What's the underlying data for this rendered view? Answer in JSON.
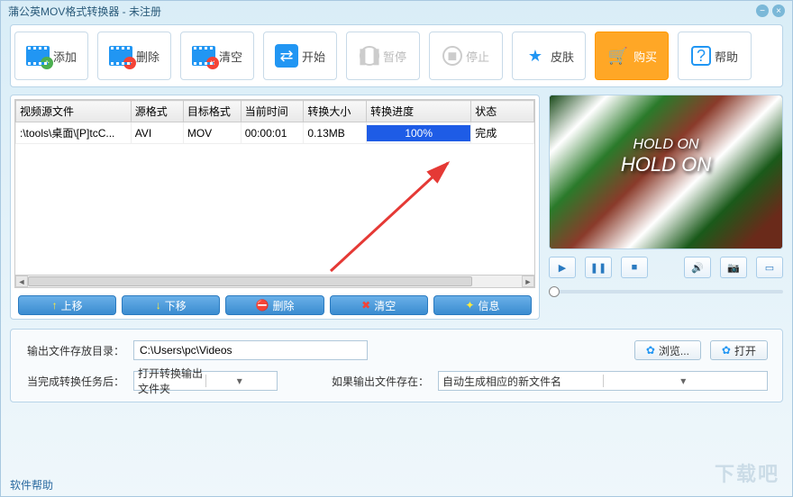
{
  "title": "蒲公英MOV格式转换器 - 未注册",
  "toolbar": {
    "add": "添加",
    "delete": "删除",
    "clear": "清空",
    "start": "开始",
    "pause": "暂停",
    "stop": "停止",
    "skin": "皮肤",
    "buy": "购买",
    "help": "帮助"
  },
  "table": {
    "headers": {
      "source": "视频源文件",
      "src_format": "源格式",
      "dst_format": "目标格式",
      "time": "当前时间",
      "size": "转换大小",
      "progress": "转换进度",
      "status": "状态"
    },
    "rows": [
      {
        "source": ":\\tools\\桌面\\[P]tcC...",
        "src_format": "AVI",
        "dst_format": "MOV",
        "time": "00:00:01",
        "size": "0.13MB",
        "progress": "100%",
        "status": "完成"
      }
    ]
  },
  "list_actions": {
    "up": "上移",
    "down": "下移",
    "delete": "删除",
    "clear": "清空",
    "info": "信息"
  },
  "preview": {
    "line1": "HOLD ON",
    "line2": "HOLD ON"
  },
  "output": {
    "dir_label": "输出文件存放目录：",
    "dir_value": "C:\\Users\\pc\\Videos",
    "browse": "浏览...",
    "open": "打开",
    "after_label": "当完成转换任务后：",
    "after_value": "打开转换输出文件夹",
    "exists_label": "如果输出文件存在：",
    "exists_value": "自动生成相应的新文件名"
  },
  "footer": "软件帮助",
  "watermark": "下载吧"
}
